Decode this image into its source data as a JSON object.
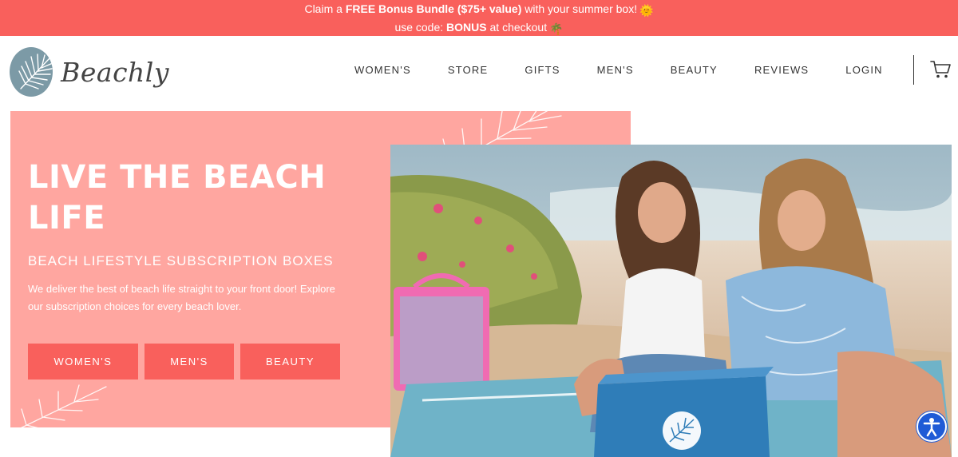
{
  "promo": {
    "line1_pre": "Claim a ",
    "line1_bold": "FREE Bonus Bundle ($75+ value)",
    "line1_post": " with your summer box!",
    "line1_emoji": "🌞",
    "line2_pre": "use code: ",
    "line2_bold": "BONUS",
    "line2_post": " at checkout",
    "line2_emoji": "🌴",
    "bg_color": "#f9605c"
  },
  "header": {
    "logo_text": "Beachly",
    "nav": [
      "WOMEN'S",
      "STORE",
      "GIFTS",
      "MEN'S",
      "BEAUTY",
      "REVIEWS",
      "LOGIN"
    ],
    "cart_icon": "cart-icon"
  },
  "hero": {
    "title": "LIVE THE BEACH LIFE",
    "subtitle": "BEACH LIFESTYLE SUBSCRIPTION BOXES",
    "description": "We deliver the best of beach life straight to your front door! Explore our subscription choices for every beach lover.",
    "buttons": [
      "WOMEN'S",
      "MEN'S",
      "BEAUTY"
    ],
    "panel_color": "#ffa6a0",
    "button_color": "#f9605c"
  },
  "photo": {
    "icon": "beach-photo"
  },
  "accessibility": {
    "icon": "accessibility-icon",
    "color": "#1f5bd6"
  }
}
